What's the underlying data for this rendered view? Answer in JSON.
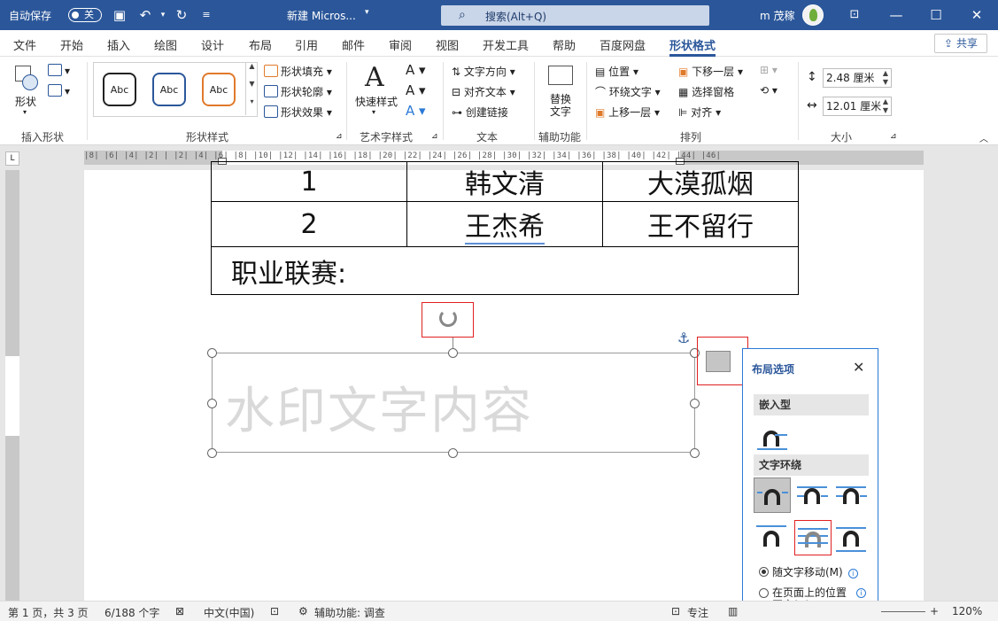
{
  "titlebar": {
    "autosave_label": "自动保存",
    "autosave_state": "关",
    "doc_title": "新建 Micros...",
    "search_placeholder": "搜索(Alt+Q)",
    "user_name": "m 茂稼",
    "title_caret": "▾"
  },
  "tabs": [
    "文件",
    "开始",
    "插入",
    "绘图",
    "设计",
    "布局",
    "引用",
    "邮件",
    "审阅",
    "视图",
    "开发工具",
    "帮助",
    "百度网盘",
    "形状格式"
  ],
  "share_label": "共享",
  "ribbon": {
    "insert_shapes": {
      "label": "插入形状",
      "shape_btn": "形状"
    },
    "shape_styles": {
      "label": "形状样式",
      "gallery": [
        "Abc",
        "Abc",
        "Abc"
      ],
      "fill": "形状填充",
      "outline": "形状轮廓",
      "effects": "形状效果"
    },
    "wordart": {
      "label": "艺术字样式",
      "quick_styles": "快速样式"
    },
    "text": {
      "label": "文本",
      "direction": "文字方向",
      "align": "对齐文本",
      "link": "创建链接"
    },
    "accessibility": {
      "label": "辅助功能",
      "alt_text": "替换文字"
    },
    "arrange": {
      "label": "排列",
      "position": "位置",
      "wrap": "环绕文字",
      "forward": "上移一层",
      "backward": "下移一层",
      "selection_pane": "选择窗格",
      "align": "对齐"
    },
    "size": {
      "label": "大小",
      "height": "2.48 厘米",
      "width": "12.01 厘米"
    }
  },
  "ruler_numbers": "|8| |6| |4| |2| | |2| |4| |6| |8| |10| |12| |14| |16| |18| |20| |22| |24| |26| |28| |30| |32| |34| |36| |38| |40| |42| |44| |46|",
  "ruler_corner": "L",
  "document": {
    "rows": [
      {
        "num": "1",
        "name": "韩文清",
        "team": "大漠孤烟"
      },
      {
        "num": "2",
        "name": "王杰希",
        "team": "王不留行"
      }
    ],
    "league_label": "职业联赛:",
    "watermark_text": "水印文字内容"
  },
  "layout_panel": {
    "title": "布局选项",
    "inline_section": "嵌入型",
    "wrap_section": "文字环绕",
    "move_with_text": "随文字移动(M)",
    "fix_position": "在页面上的位置固定(N)"
  },
  "statusbar": {
    "page": "第 1 页，共 3 页",
    "words": "6/188 个字",
    "language": "中文(中国)",
    "accessibility": "辅助功能: 调查",
    "focus": "专注",
    "zoom": "120%"
  },
  "colors": {
    "accent": "#2b579a",
    "highlight": "#e02020"
  }
}
